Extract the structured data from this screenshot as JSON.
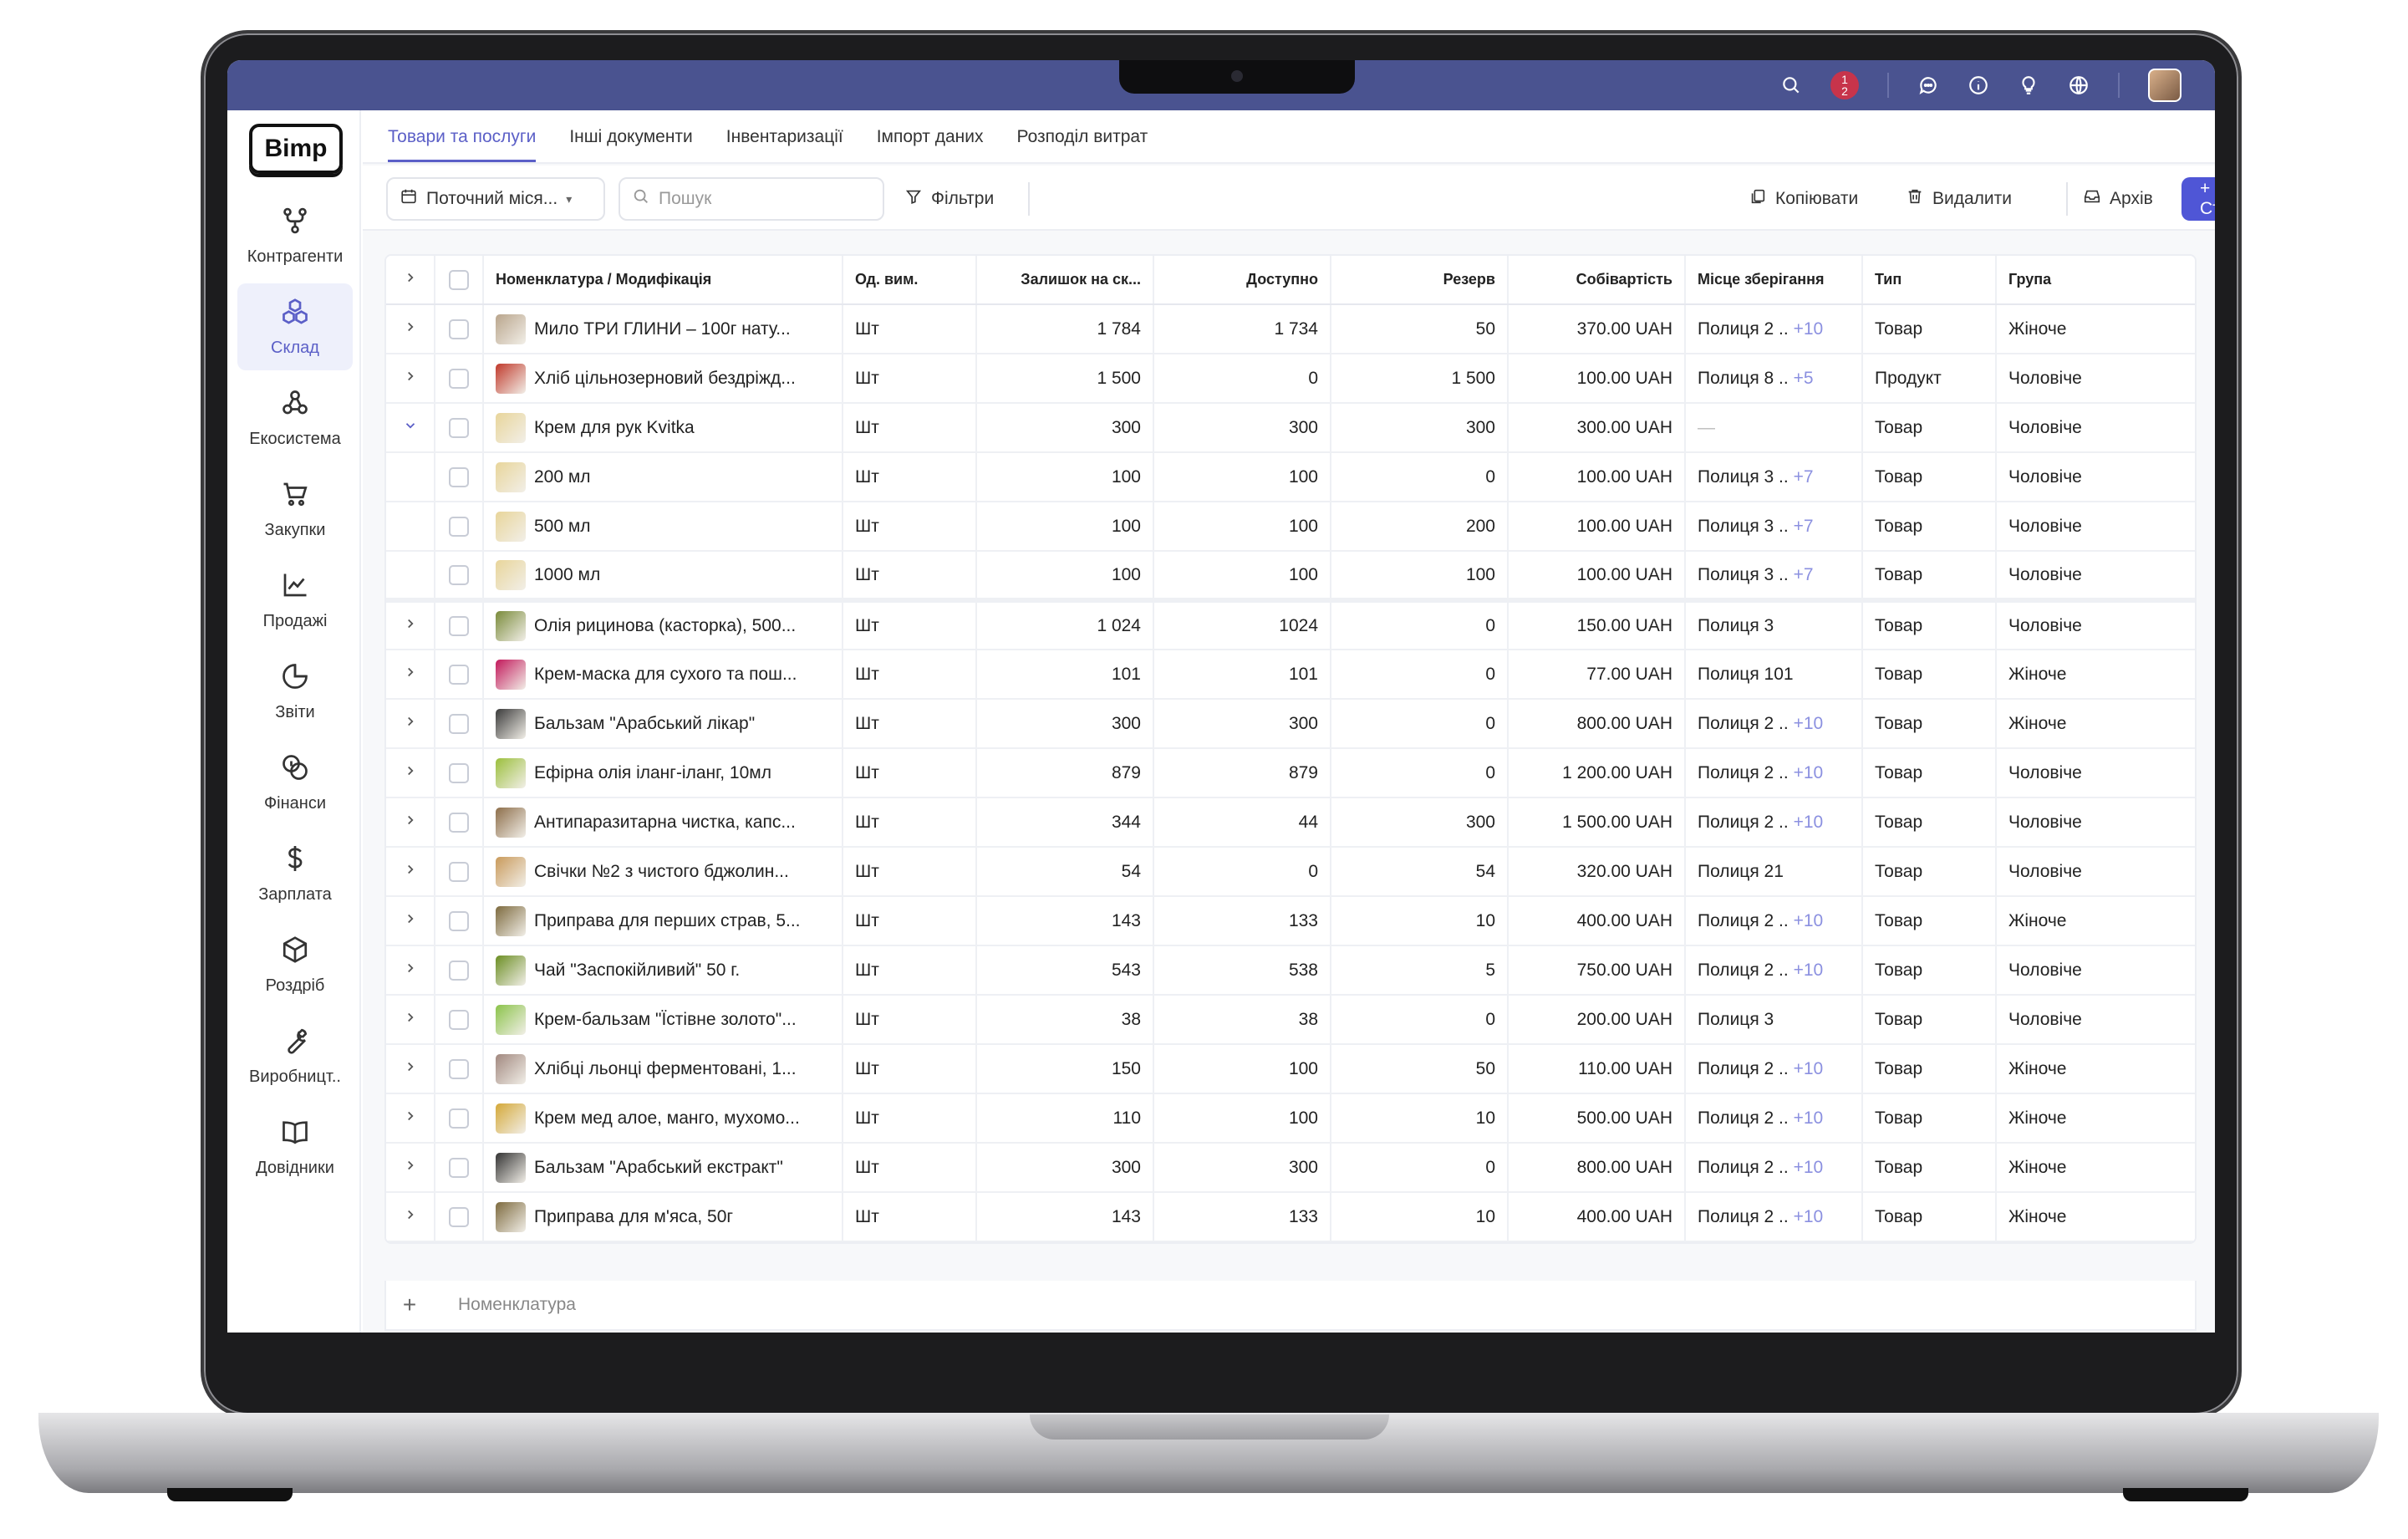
{
  "app": {
    "logo": "Bimp",
    "colors": {
      "accent": "#5b5fc7",
      "topbar": "#4a5390",
      "create_button": "#4f56d6",
      "notification": "#c7344b"
    },
    "notifications": {
      "top": "1",
      "bottom": "2"
    }
  },
  "sidebar": {
    "items": [
      {
        "label": "Контрагенти",
        "icon": "counterparties-icon"
      },
      {
        "label": "Склад",
        "icon": "warehouse-icon",
        "active": true
      },
      {
        "label": "Екосистема",
        "icon": "ecosystem-icon"
      },
      {
        "label": "Закупки",
        "icon": "cart-icon"
      },
      {
        "label": "Продажі",
        "icon": "chart-line-icon"
      },
      {
        "label": "Звіти",
        "icon": "pie-chart-icon"
      },
      {
        "label": "Фінанси",
        "icon": "coins-icon"
      },
      {
        "label": "Зарплата",
        "icon": "dollar-icon"
      },
      {
        "label": "Роздріб",
        "icon": "box-icon"
      },
      {
        "label": "Виробницт..",
        "icon": "wrench-icon"
      },
      {
        "label": "Довідники",
        "icon": "book-icon"
      }
    ]
  },
  "tabs": [
    {
      "label": "Товари та послуги",
      "active": true
    },
    {
      "label": "Інші документи"
    },
    {
      "label": "Інвентаризації"
    },
    {
      "label": "Імпорт даних"
    },
    {
      "label": "Розподіл витрат"
    }
  ],
  "toolbar": {
    "period": "Поточний міся...",
    "search_placeholder": "Пошук",
    "filters": "Фільтри",
    "copy": "Копіювати",
    "delete": "Видалити",
    "archive": "Архів",
    "create": "+ Створити"
  },
  "table": {
    "columns": [
      "Номенклатура / Модифікація",
      "Од. вим.",
      "Залишок на ск...",
      "Доступно",
      "Резерв",
      "Собівартість",
      "Місце зберігання",
      "Тип",
      "Група"
    ],
    "rows": [
      {
        "name": "Мило ТРИ ГЛИНИ – 100г нату...",
        "unit": "Шт",
        "stock": "1 784",
        "available": "1 734",
        "reserve": "50",
        "cost": "370.00 UAH",
        "location": "Полиця 2 ..",
        "more": "+10",
        "type": "Товар",
        "group": "Жіноче",
        "thumb": "#b9a58c"
      },
      {
        "name": "Хліб цільнозерновий бездріжд...",
        "unit": "Шт",
        "stock": "1 500",
        "available": "0",
        "reserve": "1 500",
        "cost": "100.00 UAH",
        "location": "Полиця 8 ..",
        "more": "+5",
        "type": "Продукт",
        "group": "Чоловіче",
        "thumb": "#c0392b"
      },
      {
        "name": "Крем для рук Kvitka",
        "unit": "Шт",
        "stock": "300",
        "available": "300",
        "reserve": "300",
        "cost": "300.00 UAH",
        "location": "",
        "more": "",
        "type": "Товар",
        "group": "Чоловіче",
        "thumb": "#e8d59a",
        "expanded": true
      },
      {
        "name": "200 мл",
        "unit": "Шт",
        "stock": "100",
        "available": "100",
        "reserve": "0",
        "cost": "100.00 UAH",
        "location": "Полиця 3 ..",
        "more": "+7",
        "type": "Товар",
        "group": "Чоловіче",
        "thumb": "#e8d59a",
        "child": true
      },
      {
        "name": "500 мл",
        "unit": "Шт",
        "stock": "100",
        "available": "100",
        "reserve": "200",
        "cost": "100.00 UAH",
        "location": "Полиця 3 ..",
        "more": "+7",
        "type": "Товар",
        "group": "Чоловіче",
        "thumb": "#e8d59a",
        "child": true
      },
      {
        "name": "1000 мл",
        "unit": "Шт",
        "stock": "100",
        "available": "100",
        "reserve": "100",
        "cost": "100.00 UAH",
        "location": "Полиця 3 ..",
        "more": "+7",
        "type": "Товар",
        "group": "Чоловіче",
        "thumb": "#e8d59a",
        "child": true,
        "group_end": true
      },
      {
        "name": "Олія рицинова (касторка), 500...",
        "unit": "Шт",
        "stock": "1 024",
        "available": "1024",
        "reserve": "0",
        "cost": "150.00 UAH",
        "location": "Полиця 3",
        "more": "",
        "type": "Товар",
        "group": "Чоловіче",
        "thumb": "#7a8b3a"
      },
      {
        "name": "Крем-маска для сухого та пош...",
        "unit": "Шт",
        "stock": "101",
        "available": "101",
        "reserve": "0",
        "cost": "77.00 UAH",
        "location": "Полиця 101",
        "more": "",
        "type": "Товар",
        "group": "Жіноче",
        "thumb": "#c2185b"
      },
      {
        "name": "Бальзам \"Арабський лікар\"",
        "unit": "Шт",
        "stock": "300",
        "available": "300",
        "reserve": "0",
        "cost": "800.00 UAH",
        "location": "Полиця 2 ..",
        "more": "+10",
        "type": "Товар",
        "group": "Жіноче",
        "thumb": "#3a3a3a"
      },
      {
        "name": "Ефірна олія іланг-іланг, 10мл",
        "unit": "Шт",
        "stock": "879",
        "available": "879",
        "reserve": "0",
        "cost": "1 200.00 UAH",
        "location": "Полиця 2 ..",
        "more": "+10",
        "type": "Товар",
        "group": "Чоловіче",
        "thumb": "#9bbf3c"
      },
      {
        "name": "Антипаразитарна чистка, капс...",
        "unit": "Шт",
        "stock": "344",
        "available": "44",
        "reserve": "300",
        "cost": "1 500.00 UAH",
        "location": "Полиця 2 ..",
        "more": "+10",
        "type": "Товар",
        "group": "Чоловіче",
        "thumb": "#8d6e4a"
      },
      {
        "name": "Свічки №2 з чистого бджолин...",
        "unit": "Шт",
        "stock": "54",
        "available": "0",
        "reserve": "54",
        "cost": "320.00 UAH",
        "location": "Полиця 21",
        "more": "",
        "type": "Товар",
        "group": "Чоловіче",
        "thumb": "#c99a5b"
      },
      {
        "name": "Приправа для перших страв, 5...",
        "unit": "Шт",
        "stock": "143",
        "available": "133",
        "reserve": "10",
        "cost": "400.00 UAH",
        "location": "Полиця 2 ..",
        "more": "+10",
        "type": "Товар",
        "group": "Жіноче",
        "thumb": "#7d6a3e"
      },
      {
        "name": "Чай \"Заспокійливий\" 50 г.",
        "unit": "Шт",
        "stock": "543",
        "available": "538",
        "reserve": "5",
        "cost": "750.00 UAH",
        "location": "Полиця 2 ..",
        "more": "+10",
        "type": "Товар",
        "group": "Чоловіче",
        "thumb": "#6b8e23"
      },
      {
        "name": "Крем-бальзам \"Їстівне золото\"...",
        "unit": "Шт",
        "stock": "38",
        "available": "38",
        "reserve": "0",
        "cost": "200.00 UAH",
        "location": "Полиця 3",
        "more": "",
        "type": "Товар",
        "group": "Чоловіче",
        "thumb": "#8bc34a"
      },
      {
        "name": "Хлібці льонці ферментовані, 1...",
        "unit": "Шт",
        "stock": "150",
        "available": "100",
        "reserve": "50",
        "cost": "110.00 UAH",
        "location": "Полиця 2 ..",
        "more": "+10",
        "type": "Товар",
        "group": "Жіноче",
        "thumb": "#a1887f"
      },
      {
        "name": "Крем мед алое, манго, мухомо...",
        "unit": "Шт",
        "stock": "110",
        "available": "100",
        "reserve": "10",
        "cost": "500.00 UAH",
        "location": "Полиця 2 ..",
        "more": "+10",
        "type": "Товар",
        "group": "Жіноче",
        "thumb": "#d4a838"
      },
      {
        "name": "Бальзам \"Арабський екстракт\"",
        "unit": "Шт",
        "stock": "300",
        "available": "300",
        "reserve": "0",
        "cost": "800.00 UAH",
        "location": "Полиця 2 ..",
        "more": "+10",
        "type": "Товар",
        "group": "Жіноче",
        "thumb": "#333333"
      },
      {
        "name": "Приправа для м'яса, 50г",
        "unit": "Шт",
        "stock": "143",
        "available": "133",
        "reserve": "10",
        "cost": "400.00 UAH",
        "location": "Полиця 2 ..",
        "more": "+10",
        "type": "Товар",
        "group": "Жіноче",
        "thumb": "#7d6a3e"
      }
    ],
    "add_placeholder": "Номенклатура",
    "empty_location": "—"
  }
}
